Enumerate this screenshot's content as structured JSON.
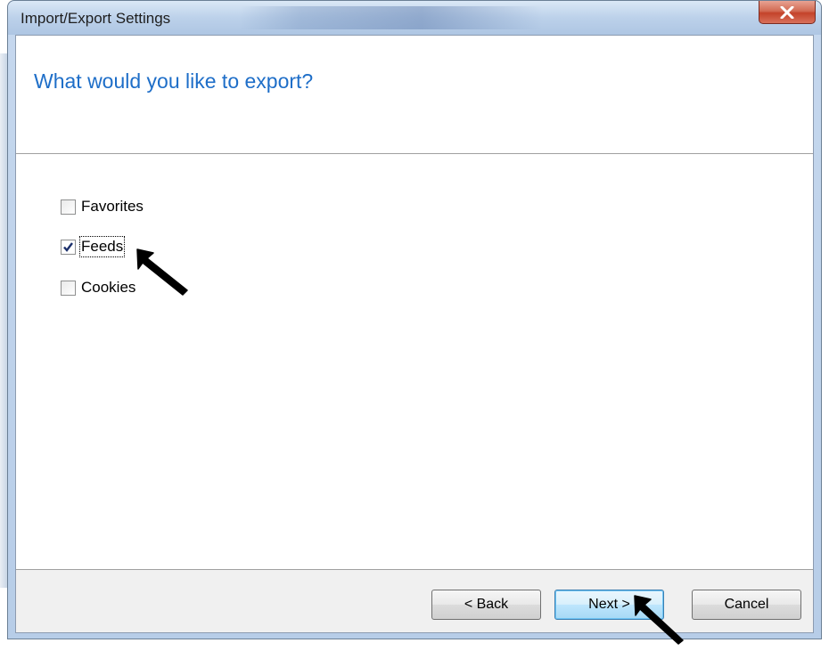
{
  "window": {
    "title": "Import/Export Settings"
  },
  "page": {
    "heading": "What would you like to export?"
  },
  "options": [
    {
      "label": "Favorites",
      "checked": false
    },
    {
      "label": "Feeds",
      "checked": true
    },
    {
      "label": "Cookies",
      "checked": false
    }
  ],
  "buttons": {
    "back": "< Back",
    "next": "Next >",
    "cancel": "Cancel"
  },
  "icons": {
    "close": "close-icon",
    "check": "checkmark-icon",
    "pointer": "arrow-pointer-icon"
  },
  "colors": {
    "heading": "#1e6ec8",
    "close_button": "#c4432a",
    "default_button_border": "#3c7fb1"
  }
}
